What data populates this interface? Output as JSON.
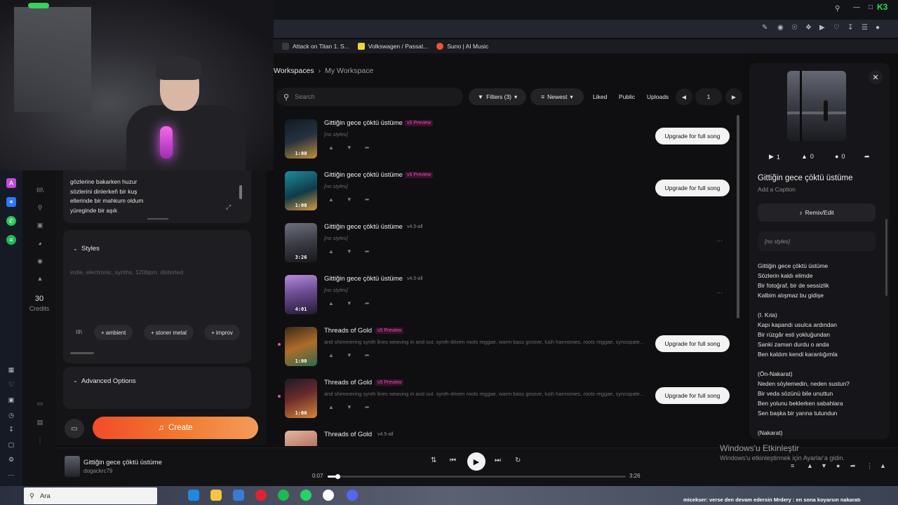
{
  "browser": {
    "bookmarks": [
      {
        "label": "Attack on Titan 1. S...",
        "color": "#3b3b3b"
      },
      {
        "label": "Volkswagen / Passat...",
        "color": "#f1d33c"
      },
      {
        "label": "Suno | AI Music",
        "color": "#f0552f"
      }
    ],
    "overlay_k": "K3"
  },
  "sidebar": {
    "credits_count": "30",
    "credits_label": "Credits"
  },
  "create": {
    "lyrics_lines": [
      "gözlerine bakarken huzur",
      "sözlerini dinlerkeň bir kuş",
      "ellerinde bir mahkum oldum",
      "yüreginde bir aşık"
    ],
    "styles_title": "Styles",
    "styles_placeholder": "indie, electronic, synths, 120bpm, distorted",
    "chips": [
      "ambient",
      "stoner metal",
      "improv"
    ],
    "advanced_title": "Advanced Options",
    "create_label": "Create"
  },
  "workspace": {
    "breadcrumb_root": "Workspaces",
    "breadcrumb_current": "My Workspace",
    "search_placeholder": "Search",
    "filters_label": "Filters (3)",
    "sort_label": "Newest",
    "liked_label": "Liked",
    "public_label": "Public",
    "uploads_label": "Uploads",
    "page": "1",
    "upgrade_label": "Upgrade for full song",
    "songs": [
      {
        "title": "Gittiğin gece çöktü üstüme",
        "badge": "v5 Preview",
        "badge_type": "v5",
        "sub": "[no styles]",
        "dur": "1:00",
        "upgrade": true,
        "grad": "linear-gradient(160deg,#0f1a22,#263240 50%,#c28f3a 100%)"
      },
      {
        "title": "Gittiğin gece çöktü üstüme",
        "badge": "v5 Preview",
        "badge_type": "v5",
        "sub": "[no styles]",
        "dur": "1:00",
        "upgrade": true,
        "grad": "linear-gradient(160deg,#1f8aa0,#103b47 55%,#d59a3c 100%)"
      },
      {
        "title": "Gittiğin gece çöktü üstüme",
        "badge": "v4.5-all",
        "badge_type": "v45",
        "sub": "[no styles]",
        "dur": "3:26",
        "upgrade": false,
        "grad": "linear-gradient(170deg,#6d707b,#3b3d45 50%,#16171b 100%)"
      },
      {
        "title": "Gittiğin gece çöktü üstüme",
        "badge": "v4.5-all",
        "badge_type": "v45",
        "sub": "[no styles]",
        "dur": "4:01",
        "upgrade": false,
        "grad": "linear-gradient(170deg,#b38bd8,#6d4c94 45%,#241a33 100%)"
      },
      {
        "title": "Threads of Gold",
        "badge": "v5 Preview",
        "badge_type": "v5",
        "sub": "and shimmering synth lines weaving in and out. synth-driven roots reggae, warm bass groove, lush harmonies, roots reggae, syncopate...",
        "dur": "1:00",
        "upgrade": true,
        "grad": "linear-gradient(160deg,#3a2a18,#b06b2a 50%,#2c6b4a 100%)"
      },
      {
        "title": "Threads of Gold",
        "badge": "v5 Preview",
        "badge_type": "v5",
        "sub": "and shimmering synth lines weaving in and out. synth-driven roots reggae, warm bass groove, lush harmonies, roots reggae, syncopate...",
        "dur": "1:00",
        "upgrade": true,
        "grad": "linear-gradient(160deg,#1b1b2a,#6a2b2b 45%,#d2873a 100%)"
      },
      {
        "title": "Threads of Gold",
        "badge": "v4.5-all",
        "badge_type": "v45",
        "sub": "",
        "dur": "",
        "upgrade": false,
        "grad": "linear-gradient(160deg,#e3b8a0,#b16b5a 60%,#3a2a2a 100%)"
      }
    ]
  },
  "detail": {
    "plays": "1",
    "likes": "0",
    "comments": "0",
    "title": "Gittiğin gece çöktü üstüme",
    "caption_placeholder": "Add a Caption",
    "remix_label": "Remix/Edit",
    "styles": "[no styles]",
    "lyrics": "Gittiğin gece çöktü üstüme\nSözlerin kaldı elimde\nBir fotoğraf, bir de sessizlik\nKalbim alışmaz bu gidişe\n\n(I. Kıta)\nKapı kapandı usulca ardından\nBir rüzgâr esti yokluğundan\nSanki zaman durdu o anda\nBen kaldım kendi karanlığımla\n\n(Ön-Nakarat)\nNeden söylemedin, neden sustun?\nBir veda sözünü bile unuttun\nBen yolunu beklerken sabahlara\nSen başka bir yarına tutundun\n\n(Nakarat)"
  },
  "player": {
    "title": "Gittiğin gece çöktü üstüme",
    "artist": "dogackrc79",
    "current": "0:07",
    "duration": "3:26",
    "progress": 0.034
  },
  "windows": {
    "activate_title": "Windows'u Etkinleştir",
    "activate_sub": "Windows'u etkinleştirmek için Ayarlar'a gidin.",
    "search_label": "Ara",
    "ticker": "micekser: verse den devam edersin   Mrdery : en sona koyarsın nakaratı"
  }
}
